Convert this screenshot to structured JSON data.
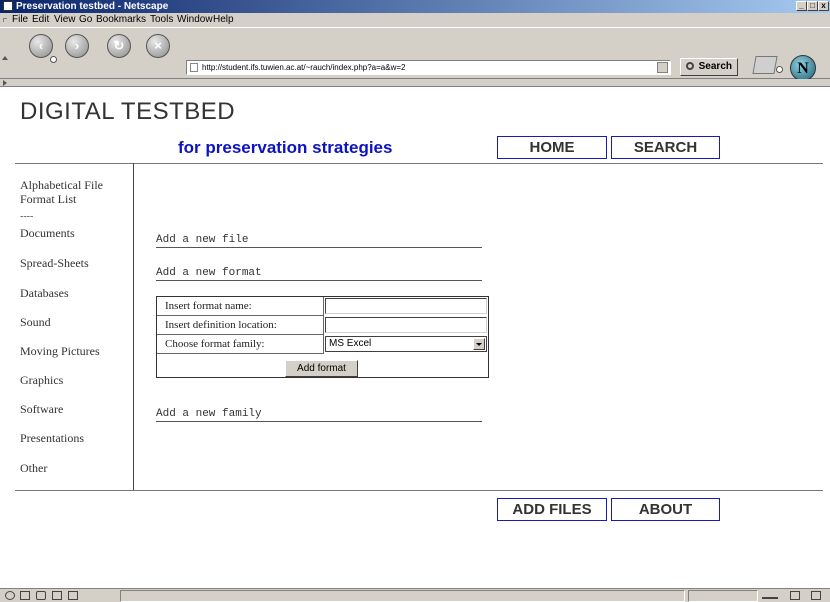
{
  "window": {
    "title": "Preservation testbed - Netscape"
  },
  "menu": {
    "items": [
      "File",
      "Edit",
      "View",
      "Go",
      "Bookmarks",
      "Tools",
      "Window",
      "Help"
    ]
  },
  "toolbar": {
    "url": "http://student.ifs.tuwien.ac.at/~rauch/index.php?a=a&w=2",
    "search_label": "Search",
    "logo_letter": "N"
  },
  "page": {
    "title": "DIGITAL TESTBED",
    "subtitle": "for preservation strategies",
    "top_nav": [
      "HOME",
      "SEARCH"
    ],
    "bottom_nav": [
      "ADD FILES",
      "ABOUT"
    ],
    "sidebar": {
      "first": "Alphabetical File Format List",
      "separator": "----",
      "items": [
        "Documents",
        "Spread-Sheets",
        "Databases",
        "Sound",
        "Moving Pictures",
        "Graphics",
        "Software",
        "Presentations",
        "Other"
      ]
    },
    "actions": {
      "add_file": "Add a new file",
      "add_format": "Add a new format",
      "add_family": "Add a new family"
    },
    "form": {
      "name_label": "Insert format name:",
      "name_value": "",
      "location_label": "Insert definition location:",
      "location_value": "",
      "family_label": "Choose format family:",
      "family_value": "MS Excel",
      "submit_label": "Add format"
    }
  }
}
